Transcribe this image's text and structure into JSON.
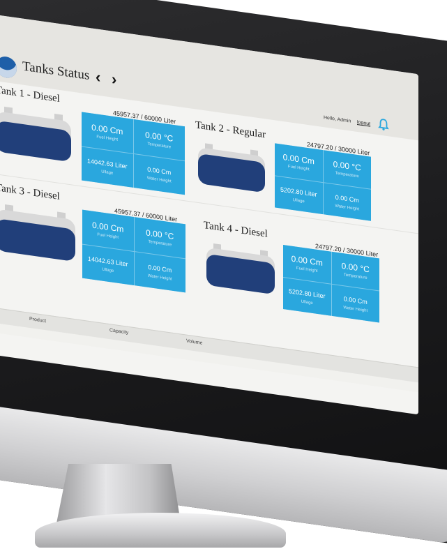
{
  "app": {
    "title": "Tanks Status",
    "prev_icon": "chevron-left-icon",
    "next_icon": "chevron-right-icon"
  },
  "header": {
    "greeting": "Hello, Admin",
    "logout": "logout",
    "bell_icon": "bell-icon"
  },
  "colors": {
    "accent": "#2aa7de",
    "tank_fill": "#213f7a",
    "header_bg": "#e6e5e1"
  },
  "tanks": [
    {
      "title": "Tank 1 - Diesel",
      "capacity": "45957.37 / 60000 Liter",
      "fill_fraction": 0.77,
      "metrics": {
        "fuel_height_value": "0.00 Cm",
        "fuel_height_label": "Fuel Height",
        "temperature_value": "0.00 °C",
        "temperature_label": "Temperature",
        "ullage_value": "14042.63 Liter",
        "ullage_label": "Ullage",
        "water_height_value": "0.00 Cm",
        "water_height_label": "Water Height"
      }
    },
    {
      "title": "Tank 2 - Regular",
      "capacity": "24797.20 / 30000 Liter",
      "fill_fraction": 0.83,
      "metrics": {
        "fuel_height_value": "0.00 Cm",
        "fuel_height_label": "Fuel Height",
        "temperature_value": "0.00 °C",
        "temperature_label": "Temperature",
        "ullage_value": "5202.80 Liter",
        "ullage_label": "Ullage",
        "water_height_value": "0.00 Cm",
        "water_height_label": "Water Height"
      }
    },
    {
      "title": "Tank 3 - Diesel",
      "capacity": "45957.37 / 60000 Liter",
      "fill_fraction": 0.77,
      "metrics": {
        "fuel_height_value": "0.00 Cm",
        "fuel_height_label": "Fuel Height",
        "temperature_value": "0.00 °C",
        "temperature_label": "Temperature",
        "ullage_value": "14042.63 Liter",
        "ullage_label": "Ullage",
        "water_height_value": "0.00 Cm",
        "water_height_label": "Water Height"
      }
    },
    {
      "title": "Tank 4 - Diesel",
      "capacity": "24797.20 / 30000 Liter",
      "fill_fraction": 0.83,
      "metrics": {
        "fuel_height_value": "0.00 Cm",
        "fuel_height_label": "Fuel Height",
        "temperature_value": "0.00 °C",
        "temperature_label": "Temperature",
        "ullage_value": "5202.80 Liter",
        "ullage_label": "Ullage",
        "water_height_value": "0.00 Cm",
        "water_height_label": "Water Height"
      }
    }
  ],
  "table": {
    "columns": [
      "Product",
      "Capacity",
      "Volume"
    ]
  }
}
